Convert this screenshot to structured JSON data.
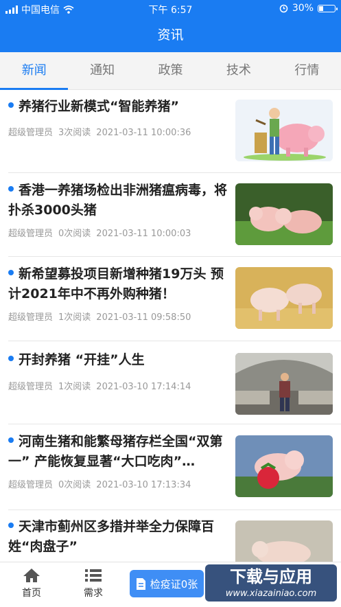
{
  "status_bar": {
    "carrier": "中国电信",
    "time": "下午 6:57",
    "battery": "30%",
    "battery_level": 0.3
  },
  "header": {
    "title": "资讯"
  },
  "tabs": [
    {
      "label": "新闻",
      "active": true
    },
    {
      "label": "通知",
      "active": false
    },
    {
      "label": "政策",
      "active": false
    },
    {
      "label": "技术",
      "active": false
    },
    {
      "label": "行情",
      "active": false
    }
  ],
  "news": [
    {
      "title": "养猪行业新模式“智能养猪”",
      "author": "超级管理员",
      "reads": "3次阅读",
      "date": "2021-03-11 10:00:36",
      "image": "cartoon-farmer-feeding-pig"
    },
    {
      "title": "香港一养猪场检出非洲猪瘟病毒，将扑杀3000头猪",
      "author": "超级管理员",
      "reads": "0次阅读",
      "date": "2021-03-11 10:00:03",
      "image": "piglets-on-grass"
    },
    {
      "title": "新希望募投项目新增种猪19万头 预计2021年中不再外购种猪！",
      "author": "超级管理员",
      "reads": "1次阅读",
      "date": "2021-03-11 09:58:50",
      "image": "piglets-on-straw"
    },
    {
      "title": "开封养猪 “开挂”人生",
      "author": "超级管理员",
      "reads": "1次阅读",
      "date": "2021-03-10 17:14:14",
      "image": "man-in-pig-barn"
    },
    {
      "title": "河南生猪和能繁母猪存栏全国“双第一” 产能恢复显著“大口吃肉”…",
      "author": "超级管理员",
      "reads": "0次阅读",
      "date": "2021-03-10 17:13:34",
      "image": "piglet-with-strawberry"
    },
    {
      "title": "天津市蓟州区多措并举全力保障百姓“肉盘子”",
      "author": "",
      "reads": "",
      "date": "",
      "image": "pig-in-sunlight"
    }
  ],
  "tabbar": {
    "home": "首页",
    "demand": "需求",
    "certificate": "检疫证0张"
  },
  "watermark": {
    "line1": "下载与应用",
    "line2": "www.xiazainiao.com"
  }
}
